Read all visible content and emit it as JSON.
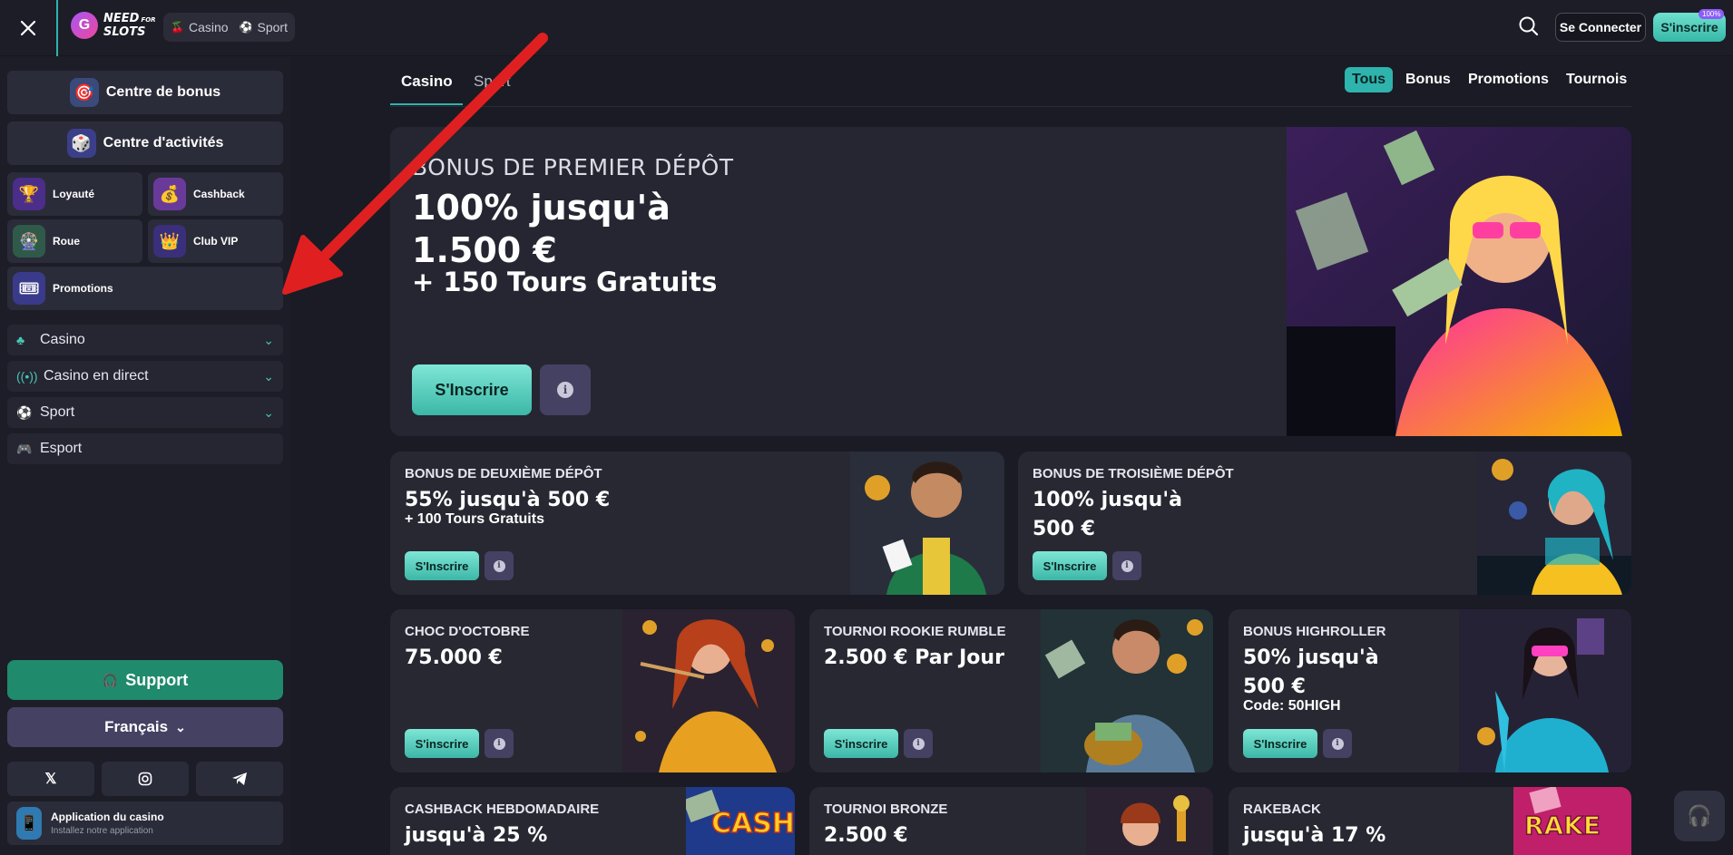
{
  "header": {
    "logo_text_top": "NEED",
    "logo_text_sup": "FOR",
    "logo_text_bottom": "SLOTS",
    "tabs": [
      {
        "label": "Casino",
        "icon": "cherries-icon"
      },
      {
        "label": "Sport",
        "icon": "soccer-ball-icon"
      }
    ],
    "login_label": "Se Connecter",
    "signup_label": "S'inscrire",
    "signup_badge": "100%"
  },
  "sidebar": {
    "bonus_center": "Centre de bonus",
    "activity_center": "Centre d'activités",
    "tiles": {
      "loyalty": "Loyauté",
      "cashback": "Cashback",
      "wheel": "Roue",
      "vip": "Club VIP",
      "promotions": "Promotions"
    },
    "nav": {
      "casino": "Casino",
      "live": "Casino en direct",
      "sport": "Sport",
      "esport": "Esport"
    },
    "support": "Support",
    "language": "Français",
    "app_title": "Application du casino",
    "app_sub": "Installez notre application"
  },
  "main": {
    "tabs": {
      "casino": "Casino",
      "sport": "Sport"
    },
    "filters": {
      "all": "Tous",
      "bonus": "Bonus",
      "promotions": "Promotions",
      "tournaments": "Tournois"
    },
    "accent": "#2fb3ad",
    "hero": {
      "kicker": "BONUS DE PREMIER DÉPÔT",
      "title_line1": "100% jusqu'à",
      "title_line2": "1.500 €",
      "sub": "+ 150 Tours Gratuits",
      "button": "S'Inscrire"
    },
    "cards": [
      {
        "kicker": "BONUS DE DEUXIÈME DÉPÔT",
        "title1": "55% jusqu'à 500 €",
        "title2": "",
        "sub": "+ 100 Tours Gratuits",
        "button": "S'Inscrire"
      },
      {
        "kicker": "BONUS DE TROISIÈME DÉPÔT",
        "title1": "100% jusqu'à",
        "title2": "500 €",
        "sub": "",
        "button": "S'Inscrire"
      },
      {
        "kicker": "CHOC D'OCTOBRE",
        "title1": "75.000 €",
        "title2": "",
        "sub": "",
        "button": "S'inscrire"
      },
      {
        "kicker": "TOURNOI ROOKIE RUMBLE",
        "title1": "2.500 € Par Jour",
        "title2": "",
        "sub": "",
        "button": "S'inscrire"
      },
      {
        "kicker": "BONUS HIGHROLLER",
        "title1": "50% jusqu'à",
        "title2": "500 €",
        "sub": "Code: 50HIGH",
        "button": "S'Inscrire"
      },
      {
        "kicker": "CASHBACK HEBDOMADAIRE",
        "title1": "jusqu'à 25 %",
        "title2": "",
        "sub": "",
        "button": ""
      },
      {
        "kicker": "TOURNOI BRONZE",
        "title1": "2.500 €",
        "title2": "",
        "sub": "",
        "button": ""
      },
      {
        "kicker": "RAKEBACK",
        "title1": "jusqu'à 17 %",
        "title2": "",
        "sub": "",
        "button": ""
      }
    ],
    "art_text": {
      "cashback": "CASH",
      "rakeback": "RAKE"
    }
  }
}
